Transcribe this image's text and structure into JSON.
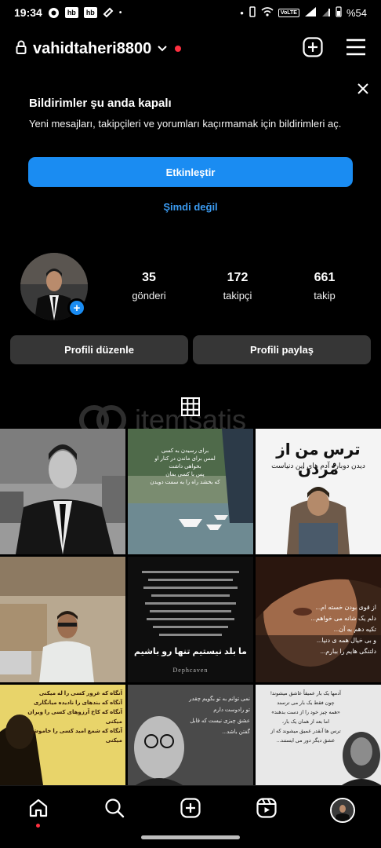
{
  "status_bar": {
    "time": "19:34",
    "icons_left": [
      "notification-icon",
      "hb",
      "hb",
      "tag-icon"
    ],
    "hb_label": "hb",
    "volte": "VoLTE",
    "battery": "%54"
  },
  "header": {
    "username": "vahidtaheri8800"
  },
  "notification": {
    "title": "Bildirimler şu anda kapalı",
    "text": "Yeni mesajları, takipçileri ve yorumları kaçırmamak için bildirimleri aç.",
    "enable_label": "Etkinleştir",
    "later_label": "Şimdi değil"
  },
  "profile": {
    "stats": [
      {
        "value": "35",
        "label": "gönderi"
      },
      {
        "value": "172",
        "label": "takipçi"
      },
      {
        "value": "661",
        "label": "takip"
      }
    ],
    "edit_label": "Profili düzenle",
    "share_label": "Profili paylaş"
  },
  "watermark": "itemsatis",
  "grid": {
    "post_texts": {
      "p3_title": "ترس من از مُردن",
      "p3_sub": "دیدن دوباره آدم های این دنیاست",
      "p5_footer": "ما بلد نیستیم تنها رو باشیم",
      "p5_brand": "Dephcaven",
      "p6_lines": [
        "از قوی بودن خسته ام...",
        "دلم یک شانه می خواهم...",
        "تکیه دهم به آن...",
        "و بی خیال همه ی دنیا...",
        "دلتنگی هایم را ببارم..."
      ],
      "p2_lines": [
        "برای رسیدن به کسی",
        "لمس برای ماندن در کنار او",
        "بخواهی داشت",
        "پس با کسی بمان",
        "که بخشد راه را به سمت دویدن"
      ],
      "p7_lines": [
        "آنگاه که غرور کسی را له میکنی",
        "آنگاه که بندهای را نادیده میانگاری",
        "آنگاه که کاخ آرزوهای کسی را ویران میکنی",
        "آنگاه که شمع امید کسی را خاموش میکنی"
      ],
      "p8_lines": [
        "نمی توانم به تو بگویم چقدر",
        "تو رادوست دارم",
        "عشق چیزی نیست که قابل",
        "گفتن باشد..."
      ],
      "p9_lines": [
        "آدمها یک بار عمیقاً عاشق میشوند!",
        "چون فقط یک بار می ترسند",
        "«همه چیز خود را از دست بدهند»",
        "اما بعد از همان یک بار،",
        "ترس ها آنقدر عمیق میشوند که از",
        "عشق دیگر دور می ایستند..."
      ]
    }
  },
  "bottom_nav": {
    "items": [
      "home-icon",
      "search-icon",
      "create-icon",
      "reels-icon",
      "profile-avatar"
    ]
  }
}
